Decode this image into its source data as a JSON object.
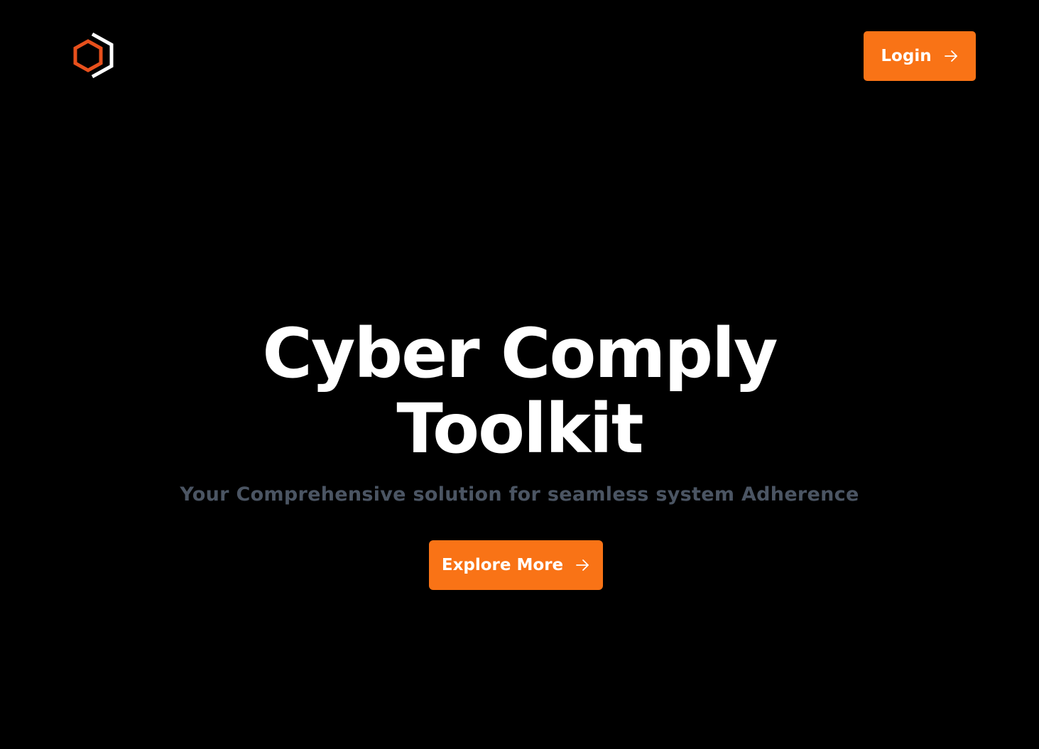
{
  "header": {
    "logo_icon": "hexagon-logo-icon",
    "logo_colors": {
      "outer": "#ffffff",
      "inner": "#e8501c"
    },
    "login_label": "Login",
    "login_icon": "arrow-right-icon"
  },
  "hero": {
    "title_line1": "Cyber Comply",
    "title_line2": "Toolkit",
    "subtitle": "Your Comprehensive solution for seamless system Adherence",
    "cta_label": "Explore More",
    "cta_icon": "arrow-right-icon"
  },
  "colors": {
    "background": "#000000",
    "accent": "#f97316",
    "title": "#ffffff",
    "subtitle": "#4b5563"
  }
}
